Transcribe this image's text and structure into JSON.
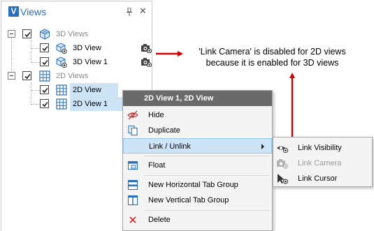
{
  "panel": {
    "logo_letter": "V",
    "title": "Views",
    "pin_symbol": "⊥",
    "close_symbol": "✕"
  },
  "tree": {
    "groups": [
      {
        "label": "3D Views",
        "checked": true,
        "items": [
          {
            "label": "3D View",
            "checked": true,
            "camera_linked": true
          },
          {
            "label": "3D View 1",
            "checked": true,
            "camera_linked": true
          }
        ]
      },
      {
        "label": "2D Views",
        "checked": true,
        "items": [
          {
            "label": "2D View",
            "checked": true
          },
          {
            "label": "2D View 1",
            "checked": true
          }
        ]
      }
    ]
  },
  "annotation": {
    "line1": "'Link Camera' is disabled for 2D views",
    "line2": "because it is enabled for 3D views",
    "arrow_color": "#d40000"
  },
  "context_menu": {
    "header": "2D View 1, 2D View",
    "items": [
      {
        "label": "Hide",
        "icon": "eye-slash-icon"
      },
      {
        "label": "Duplicate",
        "icon": "duplicate-icon"
      },
      {
        "label": "Link / Unlink",
        "icon": "",
        "has_submenu": true,
        "highlighted": true
      },
      {
        "label": "Float",
        "icon": "float-window-icon"
      },
      {
        "label": "New Horizontal Tab Group",
        "icon": "horizontal-tab-group-icon"
      },
      {
        "label": "New Vertical Tab Group",
        "icon": "vertical-tab-group-icon"
      },
      {
        "label": "Delete",
        "icon": "delete-x-icon"
      }
    ]
  },
  "submenu": {
    "items": [
      {
        "label": "Link Visibility",
        "icon": "link-visibility-icon",
        "enabled": true
      },
      {
        "label": "Link Camera",
        "icon": "link-camera-icon",
        "enabled": false
      },
      {
        "label": "Link Cursor",
        "icon": "link-cursor-icon",
        "enabled": true
      }
    ]
  },
  "colors": {
    "accent": "#2a6fbf",
    "selection": "#cde4f7",
    "menu_header": "#6a6a6a",
    "delete_red": "#d9342b"
  }
}
